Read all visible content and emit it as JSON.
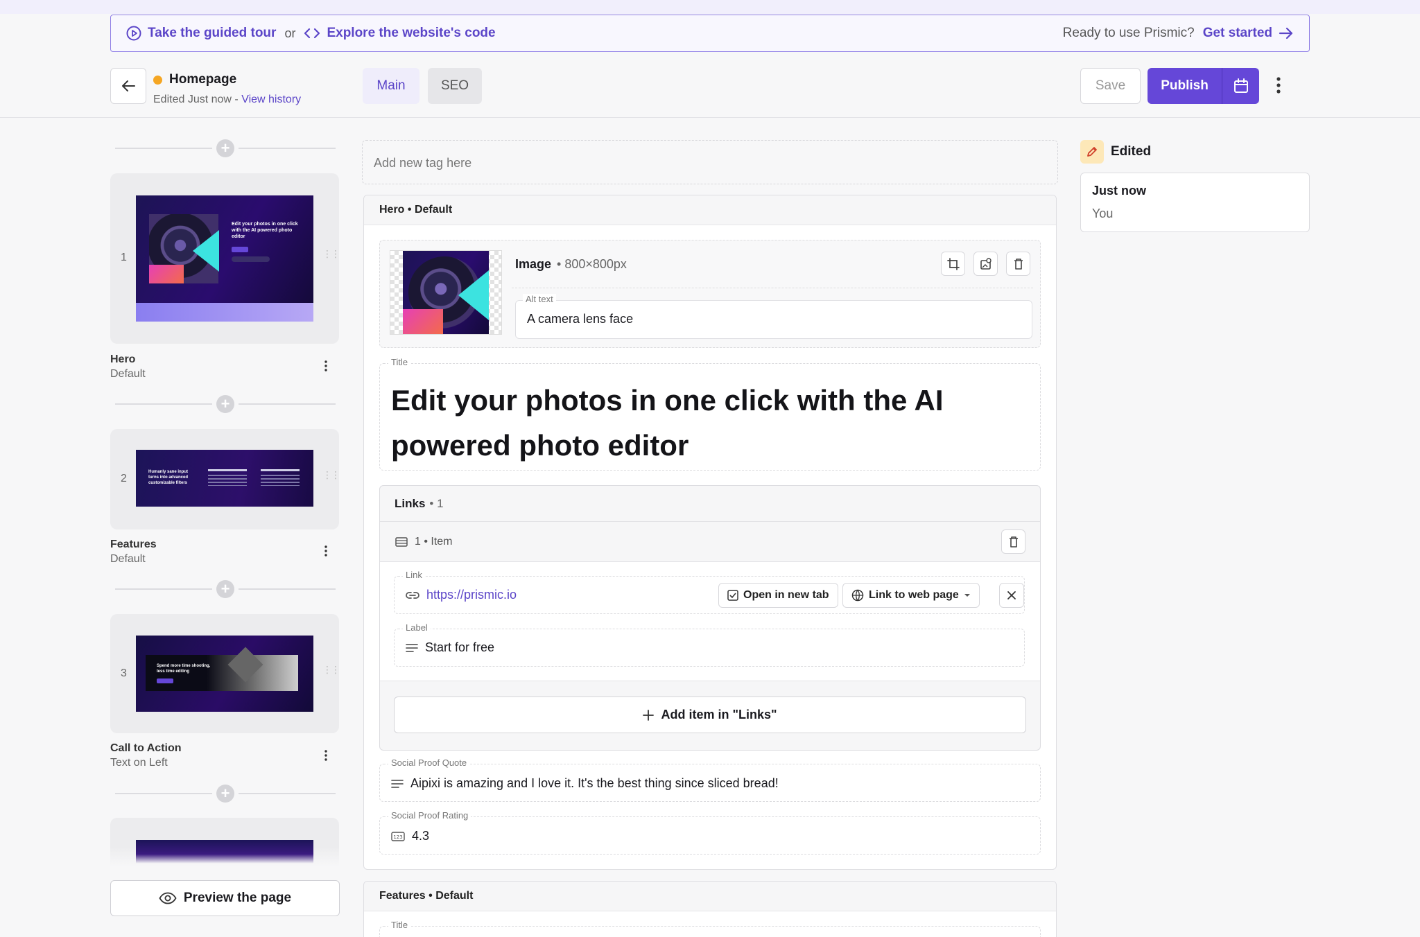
{
  "banner": {
    "tour_label": "Take the guided tour",
    "or_label": "or",
    "code_label": "Explore the website's code",
    "ready_label": "Ready to use Prismic?",
    "get_started_label": "Get started"
  },
  "document": {
    "title": "Homepage",
    "status_color": "#f5a623",
    "edited_text": "Edited Just now -",
    "history_link": "View history"
  },
  "tabs": [
    {
      "label": "Main",
      "active": true
    },
    {
      "label": "SEO",
      "active": false
    }
  ],
  "actions": {
    "save_label": "Save",
    "publish_label": "Publish"
  },
  "slices": [
    {
      "index": "1",
      "name": "Hero",
      "variation": "Default",
      "thumb_text": "Edit your photos in one click with the AI powered photo editor"
    },
    {
      "index": "2",
      "name": "Features",
      "variation": "Default",
      "thumb_text": "Humanly sane input turns into advanced customizable filters"
    },
    {
      "index": "3",
      "name": "Call to Action",
      "variation": "Text on Left",
      "thumb_text": "Spend more time shooting, less time editing"
    }
  ],
  "preview_label": "Preview the page",
  "editor": {
    "tag_placeholder": "Add new tag here",
    "hero_header": "Hero • Default",
    "image": {
      "label": "Image",
      "size": "• 800×800px",
      "alt_label": "Alt text",
      "alt_value": "A camera lens face"
    },
    "title": {
      "label": "Title",
      "value": "Edit your photos in one click with the AI powered photo editor"
    },
    "links": {
      "label": "Links",
      "count": "• 1",
      "item_label": "1 • Item",
      "link_label": "Link",
      "link_value": "https://prismic.io",
      "open_new_tab": "Open in new tab",
      "link_type": "Link to web page",
      "label_label": "Label",
      "label_value": "Start for free",
      "add_item": "Add item in \"Links\""
    },
    "social_quote": {
      "label": "Social Proof Quote",
      "value": "Aipixi is amazing and I love it. It's the best thing since sliced bread!"
    },
    "social_rating": {
      "label": "Social Proof Rating",
      "value": "4.3"
    },
    "features_header": "Features • Default",
    "features_title_label": "Title"
  },
  "history": {
    "heading": "Edited",
    "time": "Just now",
    "user": "You"
  },
  "colors": {
    "accent": "#6547d8",
    "accent_text": "#5b45c8"
  }
}
